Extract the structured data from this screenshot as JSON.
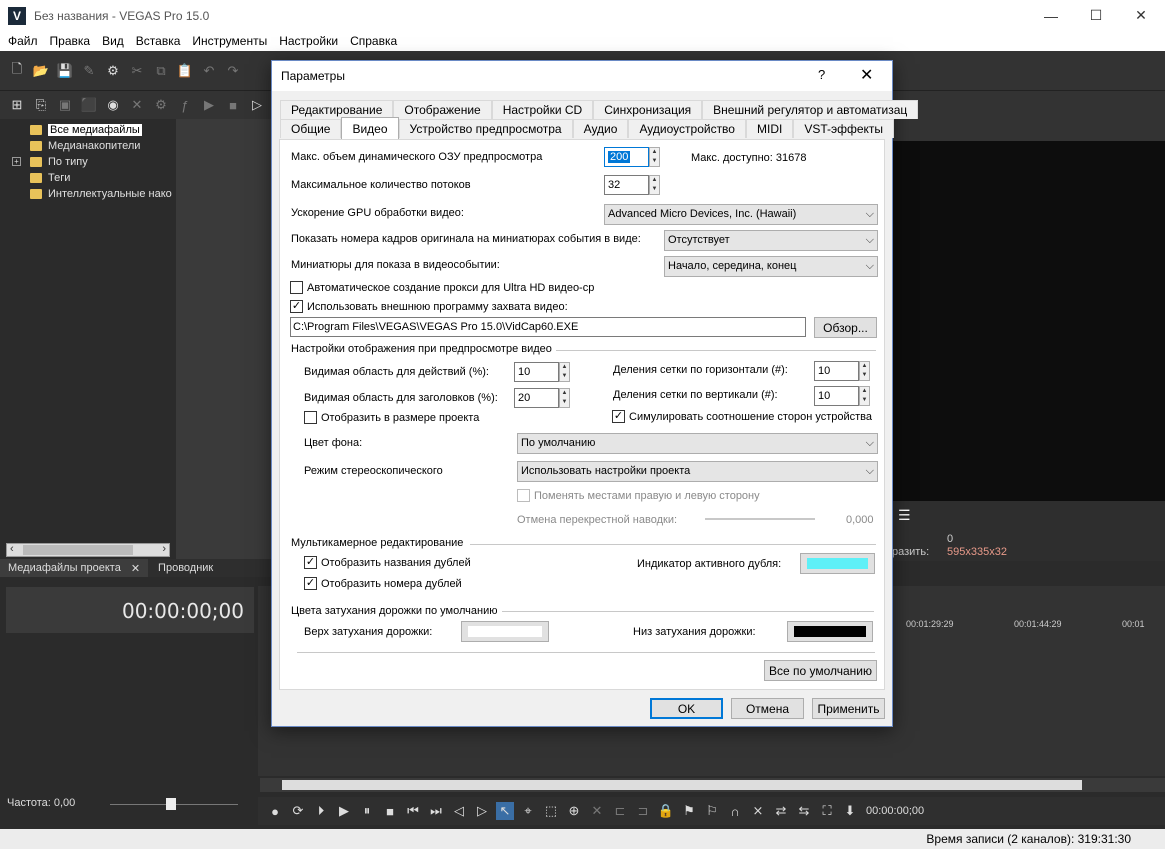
{
  "app": {
    "logo_letter": "V",
    "title": "Без названия - VEGAS Pro 15.0",
    "minimize": "—",
    "maximize": "☐",
    "close": "✕"
  },
  "menu": [
    "Файл",
    "Правка",
    "Вид",
    "Вставка",
    "Инструменты",
    "Настройки",
    "Справка"
  ],
  "tree": {
    "items": [
      {
        "label": "Все медиафайлы",
        "selected": true
      },
      {
        "label": "Медианакопители"
      },
      {
        "label": "По типу",
        "expandable": true
      },
      {
        "label": "Теги"
      },
      {
        "label": "Интеллектуальные нако"
      }
    ],
    "expander": "+"
  },
  "bottom_tabs": {
    "media": "Медиафайлы проекта",
    "close": "✕",
    "explorer": "Проводник"
  },
  "timecode": "00:00:00;00",
  "preview_info": {
    "value1": "0",
    "label2": "разить:",
    "value2": "595x335x32"
  },
  "ruler": [
    "00:01:29:29",
    "00:01:44:29",
    "00:01"
  ],
  "rate_label": "Частота: 0,00",
  "transport_time": "00:00:00;00",
  "status": "Время записи (2 каналов): 319:31:30",
  "dialog": {
    "title": "Параметры",
    "help": "?",
    "close": "✕",
    "tabs_row1": [
      "Редактирование",
      "Отображение",
      "Настройки CD",
      "Синхронизация",
      "Внешний регулятор и автоматизац"
    ],
    "tabs_row2": [
      "Общие",
      "Видео",
      "Устройство предпросмотра",
      "Аудио",
      "Аудиоустройство",
      "MIDI",
      "VST-эффекты"
    ],
    "active_tab": "Видео",
    "ram_label": "Макс. объем динамического ОЗУ предпросмотра",
    "ram_value": "200",
    "ram_available": "Макс. доступно: 31678",
    "threads_label": "Максимальное количество потоков",
    "threads_value": "32",
    "gpu_label": "Ускорение GPU обработки видео:",
    "gpu_value": "Advanced Micro Devices, Inc. (Hawaii)",
    "frame_numbers_label": "Показать номера кадров оригинала на миниатюрах события в виде:",
    "frame_numbers_value": "Отсутствует",
    "thumbnails_label": "Миниатюры для показа в видеособытии:",
    "thumbnails_value": "Начало, середина, конец",
    "auto_proxy_label": "Автоматическое создание прокси для Ultra HD видео-ср",
    "auto_proxy_checked": false,
    "ext_capture_label": "Использовать внешнюю программу захвата видео:",
    "ext_capture_checked": true,
    "capture_path": "C:\\Program Files\\VEGAS\\VEGAS Pro 15.0\\VidCap60.EXE",
    "browse_button": "Обзор...",
    "preview_section": "Настройки отображения при предпросмотре видео",
    "action_safe_label": "Видимая область для действий (%):",
    "action_safe_value": "10",
    "title_safe_label": "Видимая область для заголовков (%):",
    "title_safe_value": "20",
    "grid_h_label": "Деления сетки по горизонтали (#):",
    "grid_h_value": "10",
    "grid_v_label": "Деления сетки по вертикали (#):",
    "grid_v_value": "10",
    "project_size_label": "Отобразить в размере проекта",
    "project_size_checked": false,
    "simulate_aspect_label": "Симулировать соотношение сторон устройства",
    "simulate_aspect_checked": true,
    "bg_color_label": "Цвет фона:",
    "bg_color_value": "По умолчанию",
    "stereo_label": "Режим стереоскопического",
    "stereo_value": "Использовать настройки проекта",
    "swap_lr_label": "Поменять местами правую и левую сторону",
    "crosstalk_label": "Отмена перекрестной наводки:",
    "crosstalk_value": "0,000",
    "multicam_section": "Мультикамерное редактирование",
    "show_take_names_label": "Отобразить названия дублей",
    "show_take_names_checked": true,
    "show_take_numbers_label": "Отобразить номера дублей",
    "show_take_numbers_checked": true,
    "active_take_label": "Индикатор активного дубля:",
    "active_take_color": "#5ef0f7",
    "fade_section": "Цвета затухания дорожки по умолчанию",
    "fade_top_label": "Верх затухания дорожки:",
    "fade_top_color": "#ffffff",
    "fade_bottom_label": "Низ затухания дорожки:",
    "fade_bottom_color": "#000000",
    "defaults_button": "Все по умолчанию",
    "ok_button": "OK",
    "cancel_button": "Отмена",
    "apply_button": "Применить",
    "checkmark": "✓"
  }
}
